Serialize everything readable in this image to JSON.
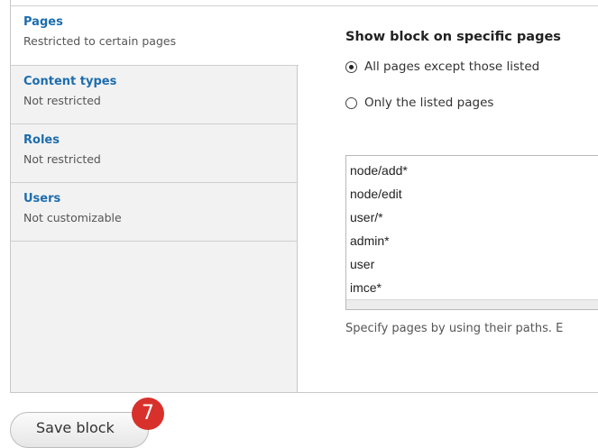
{
  "tabs": [
    {
      "title": "Pages",
      "subtitle": "Restricted to certain pages",
      "active": true
    },
    {
      "title": "Content types",
      "subtitle": "Not restricted",
      "active": false
    },
    {
      "title": "Roles",
      "subtitle": "Not restricted",
      "active": false
    },
    {
      "title": "Users",
      "subtitle": "Not customizable",
      "active": false
    }
  ],
  "pane": {
    "title": "Show block on specific pages",
    "radios": [
      {
        "label": "All pages except those listed",
        "selected": true
      },
      {
        "label": "Only the listed pages",
        "selected": false
      }
    ],
    "textarea_lines": [
      "node/add*",
      "node/edit",
      "user/*",
      "admin*",
      "user",
      "imce*"
    ],
    "help_text": "Specify pages by using their paths. E"
  },
  "actions": {
    "save_label": "Save block"
  },
  "annotation": {
    "step_number": "7",
    "color": "#d8312b"
  },
  "colors": {
    "tab_title": "#1d6dad",
    "tab_background": "#f2f2f2"
  }
}
